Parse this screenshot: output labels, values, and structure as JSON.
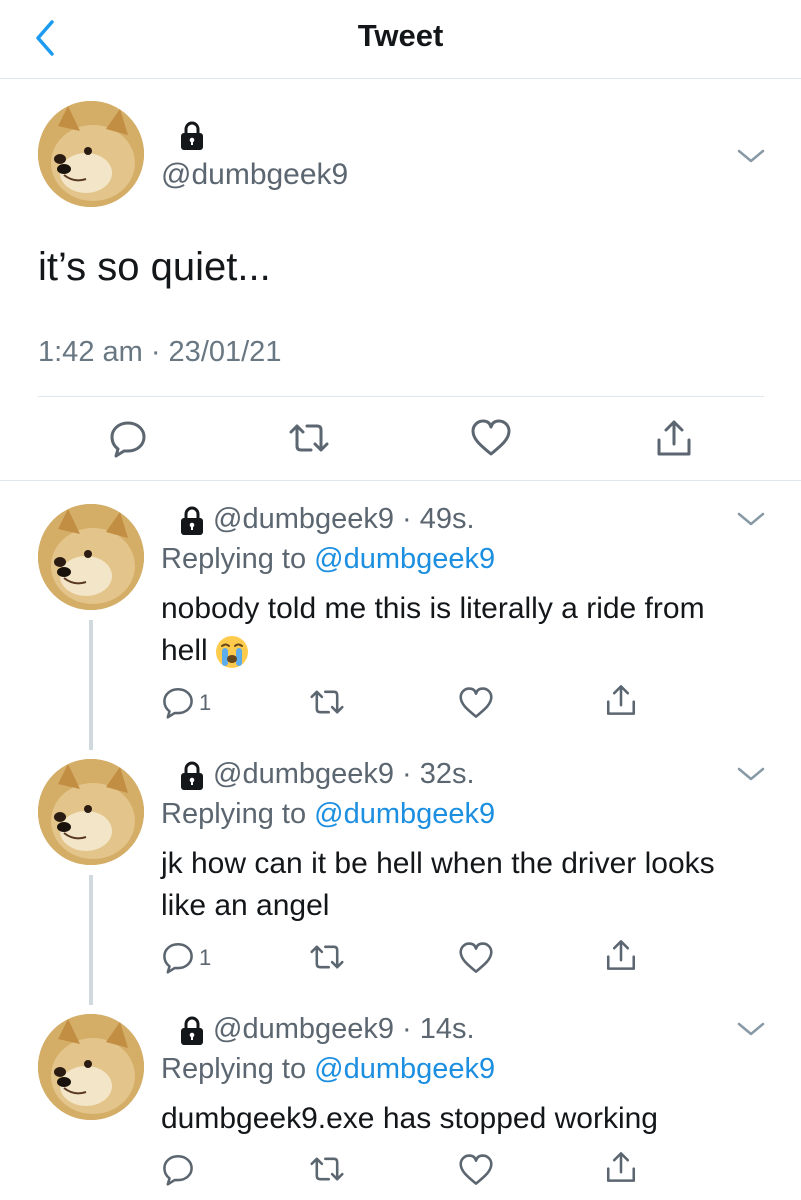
{
  "header": {
    "title": "Tweet",
    "back_icon": "chevron-left-icon",
    "accent": "#1d9bf0"
  },
  "main_tweet": {
    "handle": "@dumbgeek9",
    "text": "it’s so quiet...",
    "timestamp": "1:42 am · 23/01/21",
    "protected": true
  },
  "replies": [
    {
      "handle": "@dumbgeek9",
      "age": "49s.",
      "replying_prefix": "Replying to ",
      "replying_to": "@dumbgeek9",
      "text_line1": "nobody told me this is literally a ride from",
      "text_line2": "hell",
      "emoji": "crying-face-emoji",
      "reply_count": "1"
    },
    {
      "handle": "@dumbgeek9",
      "age": "32s.",
      "replying_prefix": "Replying to ",
      "replying_to": "@dumbgeek9",
      "text_line1": "jk how can it be hell when the driver looks",
      "text_line2": "like an angel",
      "reply_count": "1"
    },
    {
      "handle": "@dumbgeek9",
      "age": "14s.",
      "replying_prefix": "Replying to ",
      "replying_to": "@dumbgeek9",
      "text_line1": "dumbgeek9.exe has stopped working"
    }
  ],
  "colors": {
    "mention": "#1d8fe1",
    "muted": "#5b6670",
    "divider": "#e1e8ed"
  }
}
